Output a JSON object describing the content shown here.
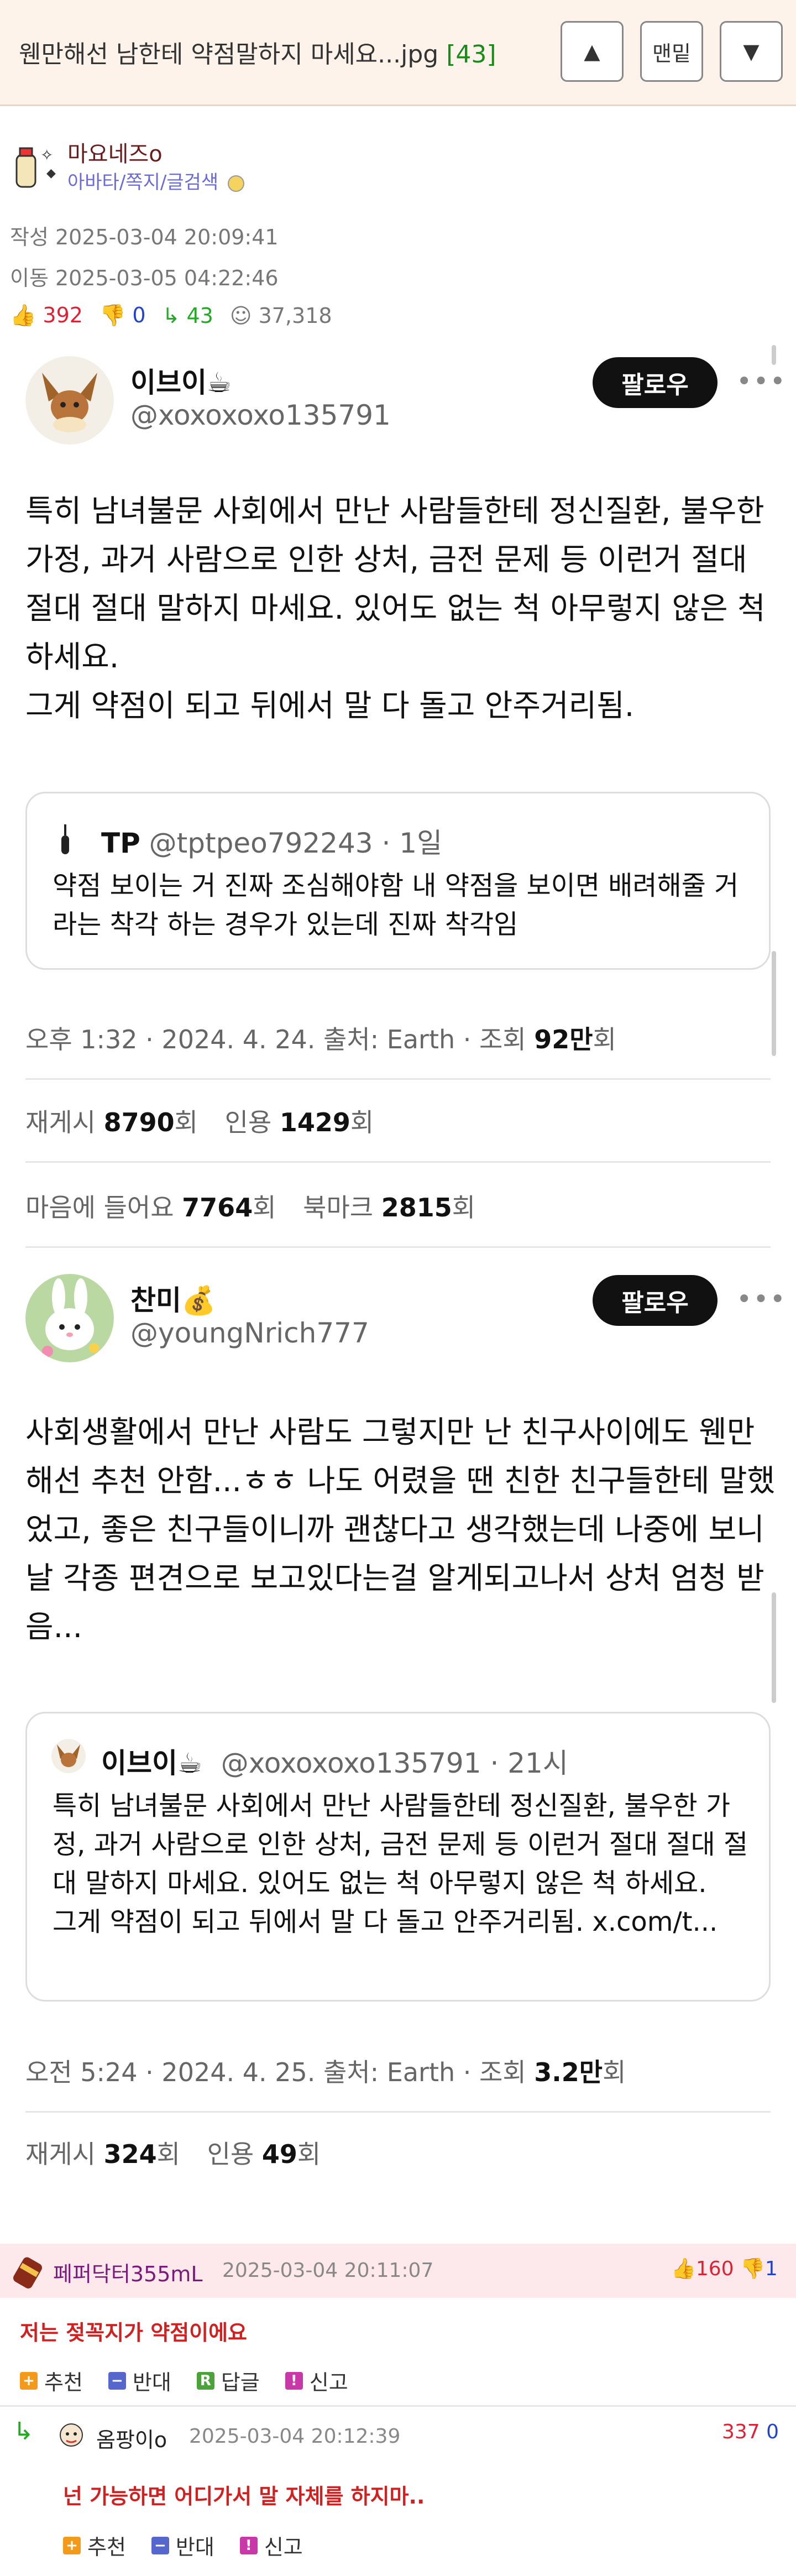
{
  "topbar": {
    "title": "웬만해선 남한테 약점말하지 마세요...jpg",
    "comment_count": "[43]",
    "up_label": "▲",
    "bottom_label": "맨밑",
    "down_label": "▼"
  },
  "author": {
    "name": "마요네즈o",
    "links": "아바타/쪽지/글검색",
    "written": "작성 2025-03-04 20:09:41",
    "moved": "이동 2025-03-05 04:22:46",
    "upvotes": "392",
    "downvotes": "0",
    "replies": "43",
    "views": "37,318"
  },
  "tweet1": {
    "name": "이브이☕",
    "handle": "@xoxoxoxo135791",
    "follow": "팔로우",
    "body": "특히 남녀불문 사회에서 만난 사람들한테 정신질환, 불우한 가정, 과거 사람으로 인한 상처, 금전 문제 등 이런거 절대 절대 절대 말하지 마세요. 있어도 없는 척 아무렇지 않은 척 하세요.\n그게 약점이 되고 뒤에서 말 다 돌고 안주거리됨.",
    "quote_name": "TP",
    "quote_handle": "@tptpeo792243 · 1일",
    "quote_body": "약점 보이는 거 진짜 조심해야함 내 약점을 보이면 배려해줄 거라는 착각 하는 경우가 있는데 진짜 착각임",
    "meta": "오후 1:32 · 2024. 4. 24. 출처: Earth · 조회 ",
    "views": "92만",
    "views_unit": "회",
    "retweet_label": "재게시 ",
    "retweets": "8790",
    "quote_label": "인용 ",
    "quotes": "1429",
    "like_label": "마음에 들어요 ",
    "likes": "7764",
    "bookmark_label": "북마크 ",
    "bookmarks": "2815",
    "unit": "회"
  },
  "tweet2": {
    "name": "찬미💰",
    "handle": "@youngNrich777",
    "follow": "팔로우",
    "body": "사회생활에서 만난 사람도 그렇지만 난 친구사이에도 웬만해선 추천 안함...ㅎㅎ 나도 어렸을 땐 친한 친구들한테 말했었고, 좋은 친구들이니까 괜찮다고 생각했는데 나중에 보니 날 각종 편견으로 보고있다는걸 알게되고나서 상처 엄청 받음...",
    "quote_name": "이브이☕",
    "quote_handle": "@xoxoxoxo135791 · 21시",
    "quote_body": "특히 남녀불문 사회에서 만난 사람들한테 정신질환, 불우한 가정, 과거 사람으로 인한 상처, 금전 문제 등 이런거 절대 절대 절대 말하지 마세요. 있어도 없는 척 아무렇지 않은 척 하세요.\n그게 약점이 되고 뒤에서 말 다 돌고 안주거리됨. x.com/t...",
    "meta": "오전 5:24 · 2024. 4. 25. 출처: Earth · 조회 ",
    "views": "3.2만",
    "views_unit": "회",
    "retweet_label": "재게시 ",
    "retweets": "324",
    "quote_label": "인용 ",
    "quotes": "49",
    "unit": "회"
  },
  "comments": [
    {
      "name": "페퍼닥터355mL",
      "date": "2025-03-04 20:11:07",
      "up": "160",
      "down": "1",
      "text": "저는 젖꼭지가 약점이에요",
      "recommend": "추천",
      "oppose": "반대",
      "reply": "답글",
      "report": "신고"
    },
    {
      "name": "옴팡이o",
      "date": "2025-03-04 20:12:39",
      "up": "337",
      "down": "0",
      "text": "넌 가능하면 어디가서 말 자체를 하지마..",
      "recommend": "추천",
      "oppose": "반대",
      "report": "신고"
    }
  ]
}
